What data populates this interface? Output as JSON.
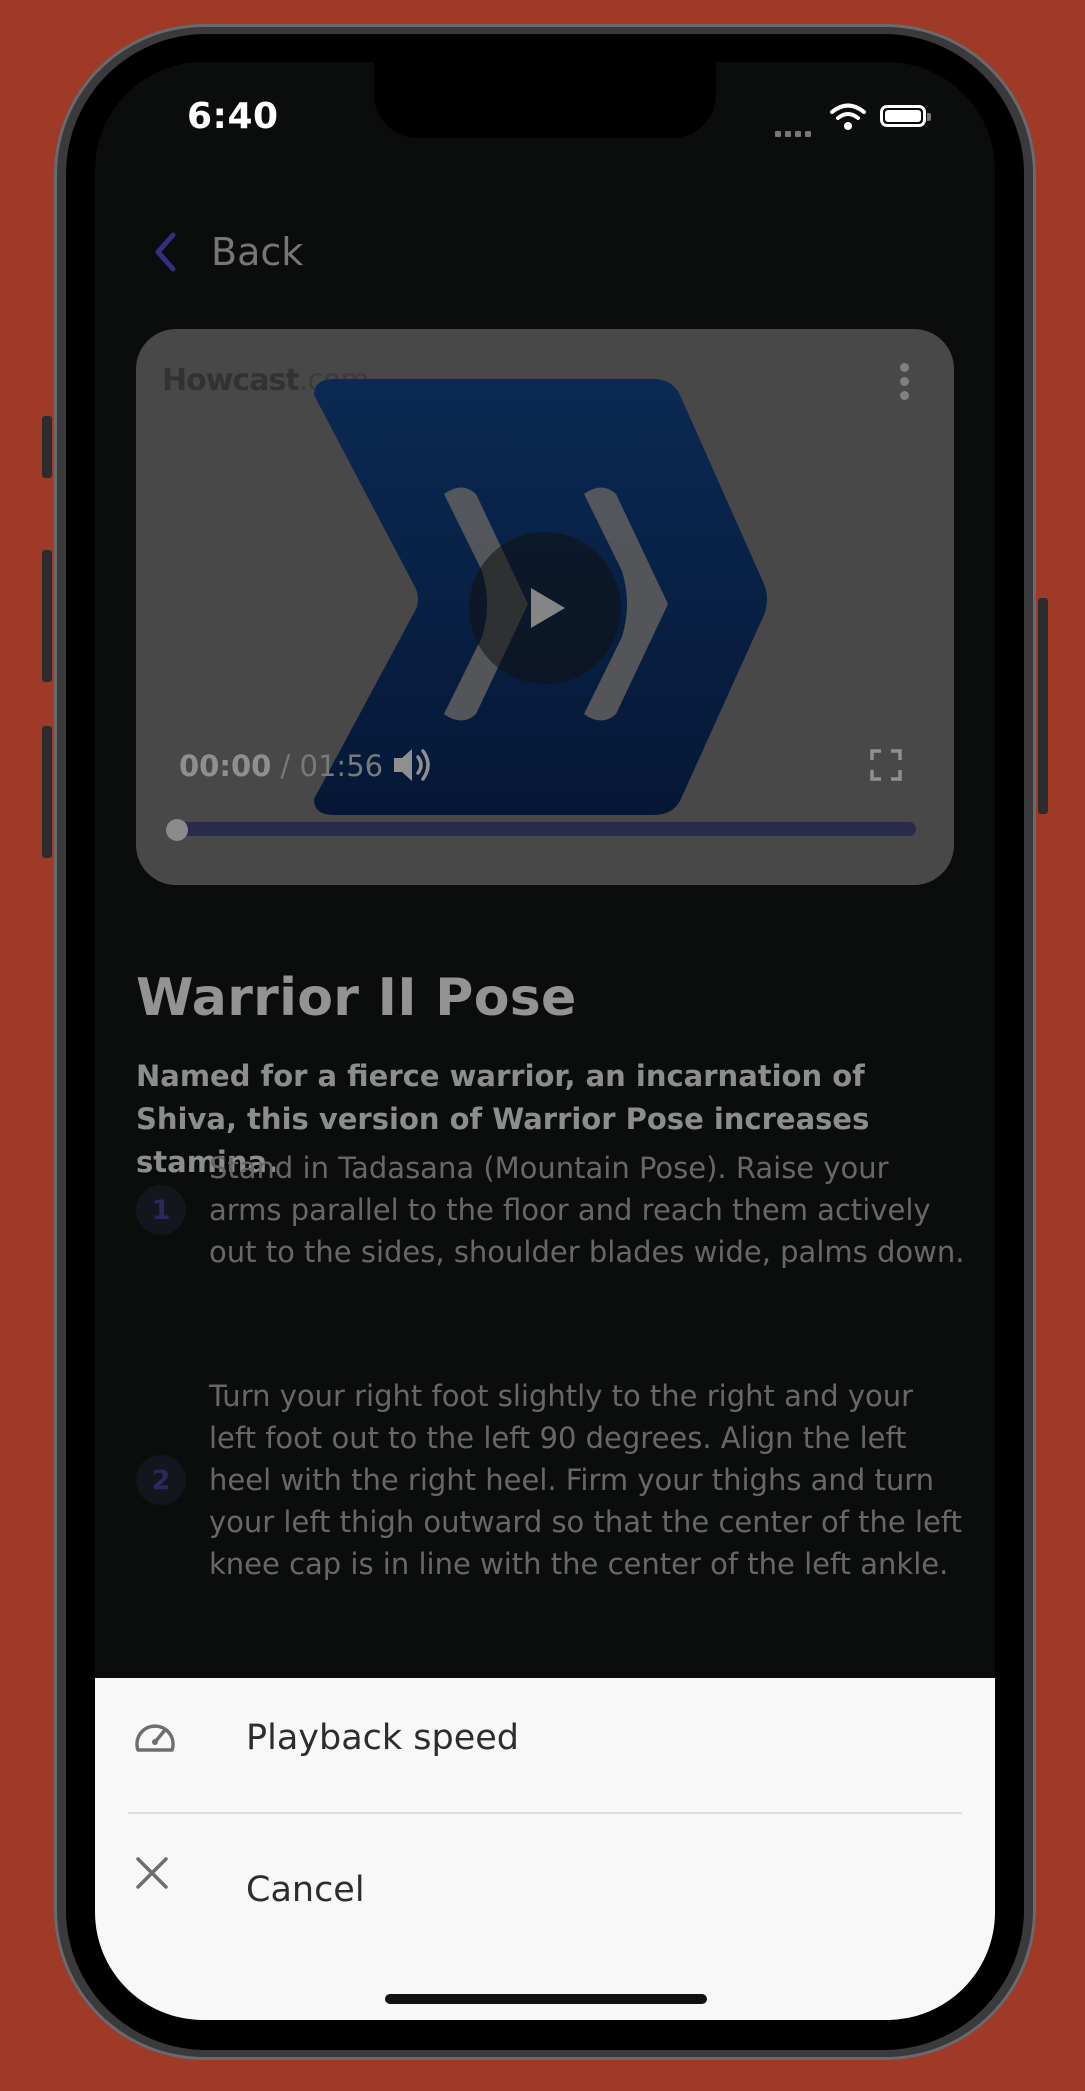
{
  "status_bar": {
    "time": "6:40"
  },
  "nav": {
    "back_label": "Back"
  },
  "video": {
    "logo_text": "Howcast",
    "logo_domain": ".com",
    "time_elapsed": "00:00",
    "time_separator": " / ",
    "time_total": "01:56",
    "progress": 0.0,
    "accent_color": "#0a3a7a"
  },
  "pose": {
    "title": "Warrior II Pose",
    "description": "Named for a fierce warrior, an incarnation of Shiva, this version of Warrior Pose increases stamina.",
    "steps": [
      {
        "number": "1",
        "text": "Stand in Tadasana (Mountain Pose). Raise your arms parallel to the floor and reach them actively out to the sides, shoulder blades wide, palms down."
      },
      {
        "number": "2",
        "text": "Turn your right foot slightly to the right and your left foot out to the left 90 degrees. Align the left heel with the right heel. Firm your thighs and turn your left thigh outward so that the center of the left knee cap is in line with the center of the left ankle."
      }
    ]
  },
  "action_sheet": {
    "items": [
      {
        "label": "Playback speed",
        "icon": "speedometer-icon"
      },
      {
        "label": "Cancel",
        "icon": "close-icon"
      }
    ]
  },
  "colors": {
    "background": "#9e3a25",
    "screen": "#0b0c0c",
    "accent": "#3d3b8a",
    "sheet": "#f8f8f8"
  }
}
